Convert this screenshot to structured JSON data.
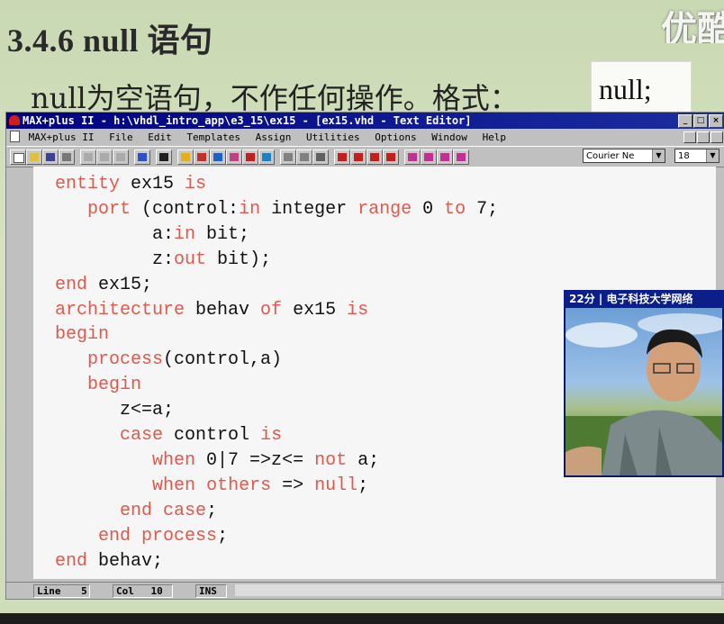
{
  "slide": {
    "heading": "3.4.6   null 语句",
    "subtitle": "null为空语句，不作任何操作。格式：",
    "null_syntax": "null;",
    "corner_logo": "优酷"
  },
  "window": {
    "title": "MAX+plus II - h:\\vhdl_intro_app\\e3_15\\ex15 - [ex15.vhd - Text Editor]",
    "menu": [
      "MAX+plus II",
      "File",
      "Edit",
      "Templates",
      "Assign",
      "Utilities",
      "Options",
      "Window",
      "Help"
    ],
    "font_name": "Courier Ne",
    "font_size": "18"
  },
  "code_lines": [
    [
      {
        "t": "entity",
        "k": 1
      },
      {
        "t": " ex15 "
      },
      {
        "t": "is",
        "k": 1
      }
    ],
    [
      {
        "t": "   "
      },
      {
        "t": "port",
        "k": 1
      },
      {
        "t": " (control:"
      },
      {
        "t": "in",
        "k": 1
      },
      {
        "t": " integer "
      },
      {
        "t": "range",
        "k": 1
      },
      {
        "t": " 0 "
      },
      {
        "t": "to",
        "k": 1
      },
      {
        "t": " 7;"
      }
    ],
    [
      {
        "t": "         a:"
      },
      {
        "t": "in",
        "k": 1
      },
      {
        "t": " bit;"
      }
    ],
    [
      {
        "t": "         z:"
      },
      {
        "t": "out",
        "k": 1
      },
      {
        "t": " bit);"
      }
    ],
    [
      {
        "t": "end",
        "k": 1
      },
      {
        "t": " ex15;"
      }
    ],
    [
      {
        "t": "architecture",
        "k": 1
      },
      {
        "t": " behav "
      },
      {
        "t": "of",
        "k": 1
      },
      {
        "t": " ex15 "
      },
      {
        "t": "is",
        "k": 1
      }
    ],
    [
      {
        "t": "begin",
        "k": 1
      }
    ],
    [
      {
        "t": "   "
      },
      {
        "t": "process",
        "k": 1
      },
      {
        "t": "(control,a)"
      }
    ],
    [
      {
        "t": "   "
      },
      {
        "t": "begin",
        "k": 1
      }
    ],
    [
      {
        "t": "      z<=a;"
      }
    ],
    [
      {
        "t": "      "
      },
      {
        "t": "case",
        "k": 1
      },
      {
        "t": " control "
      },
      {
        "t": "is",
        "k": 1
      }
    ],
    [
      {
        "t": "         "
      },
      {
        "t": "when",
        "k": 1
      },
      {
        "t": " 0|7 =>z<= "
      },
      {
        "t": "not",
        "k": 1
      },
      {
        "t": " a;"
      }
    ],
    [
      {
        "t": "         "
      },
      {
        "t": "when",
        "k": 1
      },
      {
        "t": " "
      },
      {
        "t": "others",
        "k": 1
      },
      {
        "t": " => "
      },
      {
        "t": "null",
        "k": 1
      },
      {
        "t": ";"
      }
    ],
    [
      {
        "t": "      "
      },
      {
        "t": "end",
        "k": 1
      },
      {
        "t": " "
      },
      {
        "t": "case",
        "k": 1
      },
      {
        "t": ";"
      }
    ],
    [
      {
        "t": "    "
      },
      {
        "t": "end",
        "k": 1
      },
      {
        "t": " "
      },
      {
        "t": "process",
        "k": 1
      },
      {
        "t": ";"
      }
    ],
    [
      {
        "t": "end",
        "k": 1
      },
      {
        "t": " behav;"
      }
    ]
  ],
  "status": {
    "line_label": "Line",
    "line_value": "5",
    "col_label": "Col",
    "col_value": "10",
    "mode": "INS"
  },
  "video": {
    "caption": "22分 | 电子科技大学网络"
  },
  "colors": {
    "keyword": "#e2584a",
    "title_bar": "#000080"
  }
}
